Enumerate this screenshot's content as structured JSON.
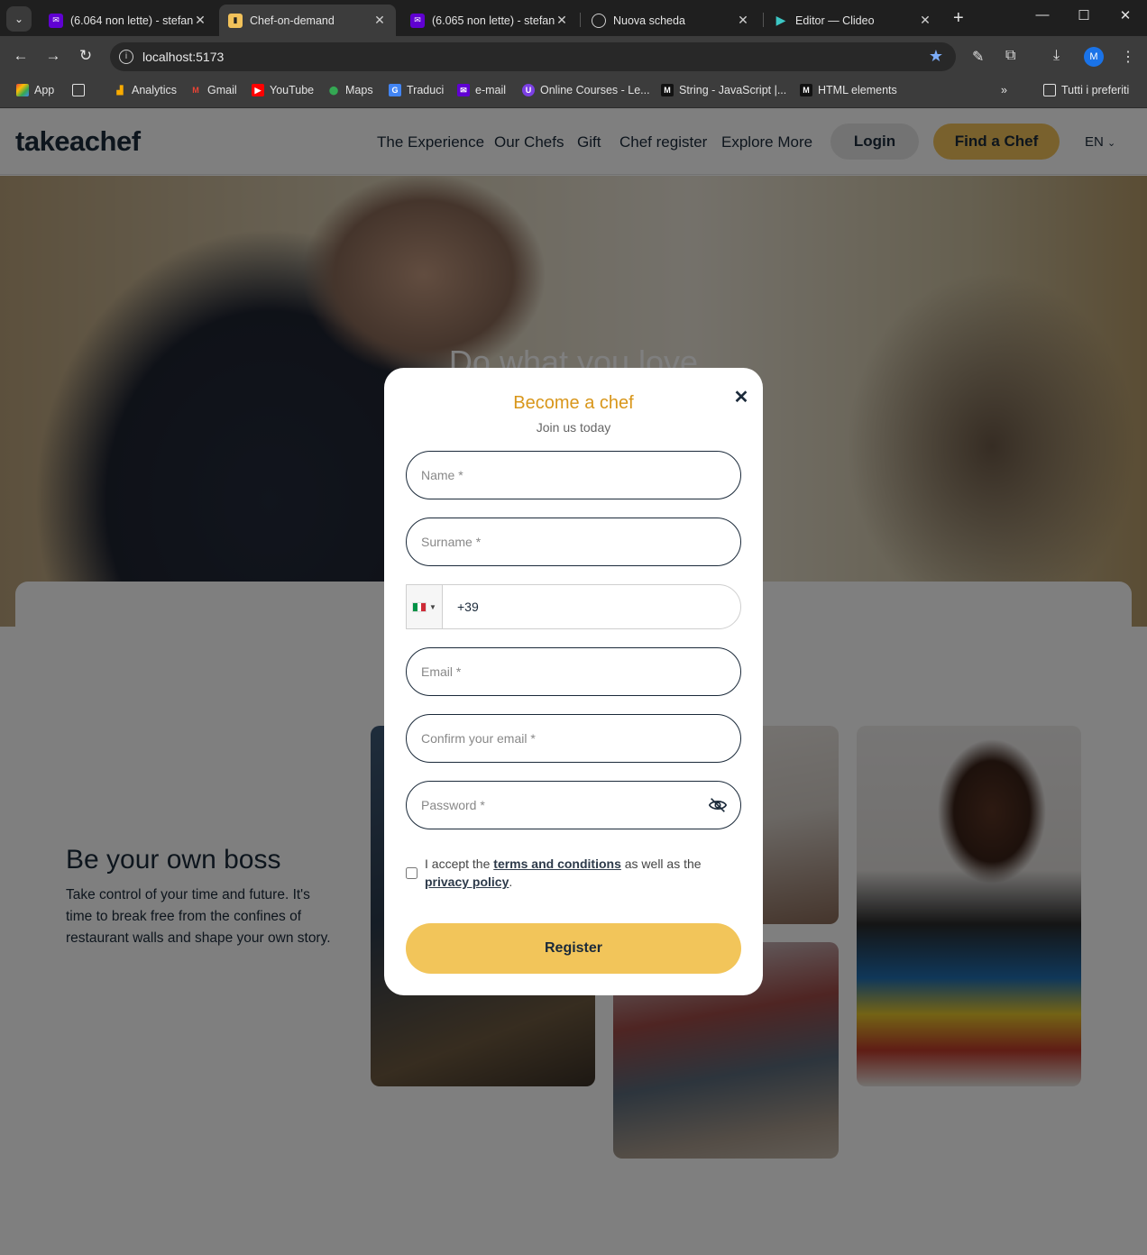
{
  "browser": {
    "tabs": [
      {
        "title": "(6.064 non lette) - stefan",
        "favicon": "yahoo-mail-icon"
      },
      {
        "title": "Chef-on-demand",
        "favicon": "vite-icon"
      },
      {
        "title": "(6.065 non lette) - stefan",
        "favicon": "yahoo-mail-icon"
      },
      {
        "title": "Nuova scheda",
        "favicon": "globe-icon"
      },
      {
        "title": "Editor — Clideo",
        "favicon": "clideo-icon"
      }
    ],
    "active_tab": 1,
    "url": "localhost:5173",
    "profile_initial": "M",
    "bookmarks": [
      {
        "label": "App"
      },
      {
        "label": "Analytics"
      },
      {
        "label": "Gmail"
      },
      {
        "label": "YouTube"
      },
      {
        "label": "Maps"
      },
      {
        "label": "Traduci"
      },
      {
        "label": "e-mail"
      },
      {
        "label": "Online Courses - Le..."
      },
      {
        "label": "String - JavaScript |..."
      },
      {
        "label": "HTML elements"
      }
    ],
    "all_bookmarks_label": "Tutti i preferiti"
  },
  "site": {
    "logo": "takeachef",
    "nav": [
      "The Experience",
      "Our Chefs",
      "Gift",
      "Chef register",
      "Explore More"
    ],
    "login_label": "Login",
    "find_chef_label": "Find a Chef",
    "language": "EN",
    "hero_title": "Do what you love",
    "section": {
      "title": "Be your own boss",
      "text": "Take control of your time and future. It's time to break free from the confines of restaurant walls and shape your own story."
    }
  },
  "modal": {
    "title": "Become a chef",
    "subtitle": "Join us today",
    "fields": {
      "name_placeholder": "Name *",
      "surname_placeholder": "Surname *",
      "phone_value": "+39",
      "email_placeholder": "Email *",
      "confirm_email_placeholder": "Confirm your email *",
      "password_placeholder": "Password *"
    },
    "terms": {
      "prefix": "I accept the ",
      "terms_link": "terms and conditions",
      "middle": " as well as the ",
      "privacy_link": "privacy policy",
      "suffix": "."
    },
    "register_label": "Register"
  },
  "colors": {
    "accent_gold": "#f2c25a",
    "title_orange": "#d8961a",
    "navy": "#1b2a3a"
  }
}
